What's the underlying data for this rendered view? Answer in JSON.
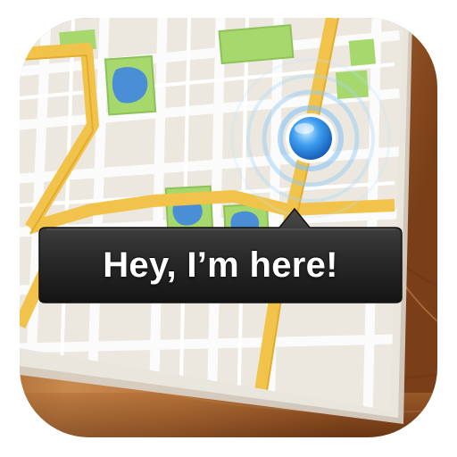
{
  "app_icon": {
    "callout_text": "Hey, I’m here!"
  },
  "colors": {
    "wood_light": "#c98a4f",
    "wood_dark": "#7a3f18",
    "map_paper": "#ece8df",
    "map_street": "#f9f9f9",
    "major_road": "#f2c34a",
    "park": "#a6d86e",
    "water": "#4a8fd6",
    "location_dot": "#3d9df0",
    "callout_bg": "#2a2a2a"
  },
  "icons": {
    "location_marker": "current-location-dot-icon",
    "signal_rings": "location-pulse-icon"
  }
}
